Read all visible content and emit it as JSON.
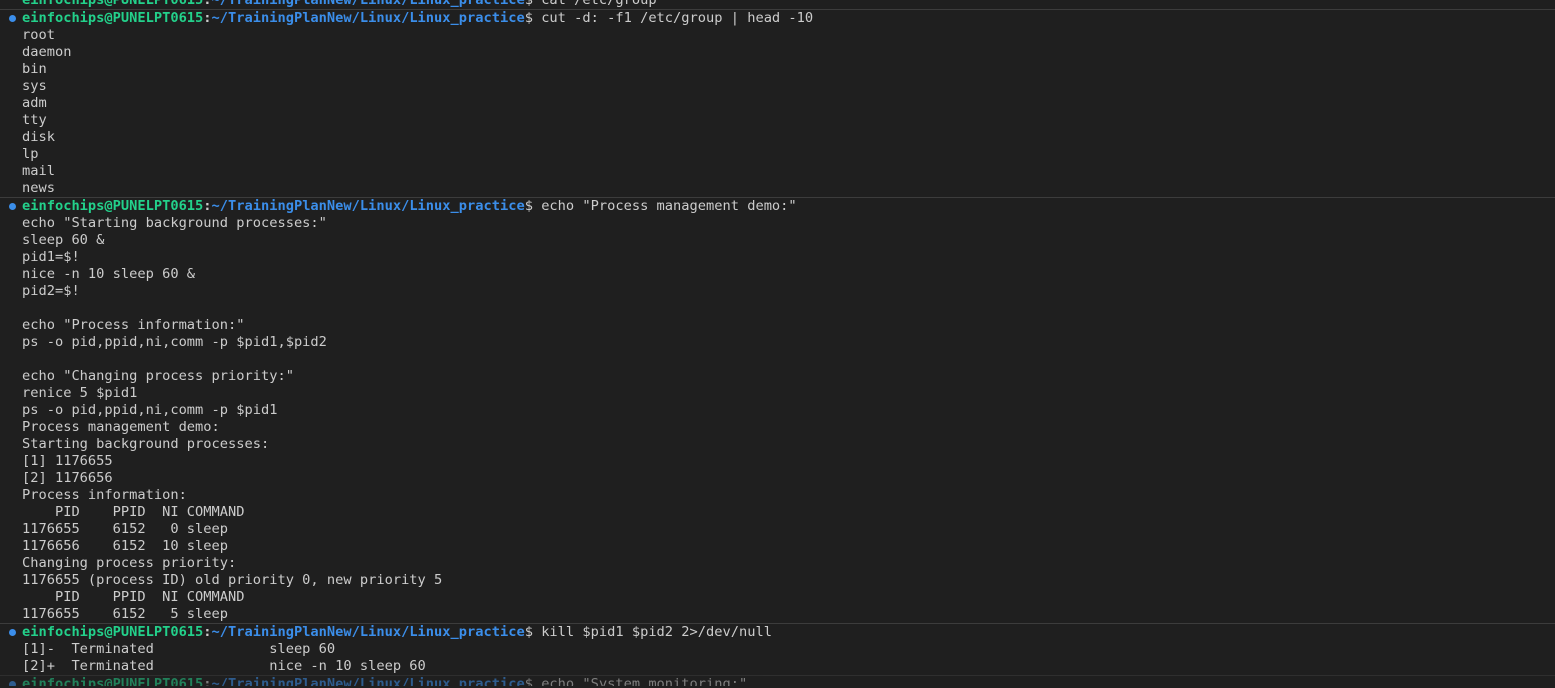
{
  "prompt": {
    "user_host": "einfochips@PUNELPT0615",
    "path": "~/TrainingPlanNew/Linux/Linux_practice",
    "symbol": "$"
  },
  "colors": {
    "background": "#1f1f1f",
    "user": "#23d18b",
    "path": "#3b8eea",
    "text": "#cccccc",
    "decoration_dot": "#3b8eea"
  },
  "blocks": [
    {
      "command": " cat /etc/group",
      "dot": false,
      "output": []
    },
    {
      "command": " cut -d: -f1 /etc/group | head -10",
      "dot": true,
      "output": [
        "root",
        "daemon",
        "bin",
        "sys",
        "adm",
        "tty",
        "disk",
        "lp",
        "mail",
        "news"
      ]
    },
    {
      "command": " echo \"Process management demo:\"",
      "dot": true,
      "output": [
        "echo \"Starting background processes:\"",
        "sleep 60 &",
        "pid1=$!",
        "nice -n 10 sleep 60 &",
        "pid2=$!",
        "",
        "echo \"Process information:\"",
        "ps -o pid,ppid,ni,comm -p $pid1,$pid2",
        "",
        "echo \"Changing process priority:\"",
        "renice 5 $pid1",
        "ps -o pid,ppid,ni,comm -p $pid1",
        "Process management demo:",
        "Starting background processes:",
        "[1] 1176655",
        "[2] 1176656",
        "Process information:",
        "    PID    PPID  NI COMMAND",
        "1176655    6152   0 sleep",
        "1176656    6152  10 sleep",
        "Changing process priority:",
        "1176655 (process ID) old priority 0, new priority 5",
        "    PID    PPID  NI COMMAND",
        "1176655    6152   5 sleep"
      ]
    },
    {
      "command": " kill $pid1 $pid2 2>/dev/null",
      "dot": true,
      "output": [
        "[1]-  Terminated              sleep 60",
        "[2]+  Terminated              nice -n 10 sleep 60"
      ]
    },
    {
      "command": " echo \"System monitoring:\"",
      "dot": true,
      "faded": true,
      "output": []
    }
  ]
}
